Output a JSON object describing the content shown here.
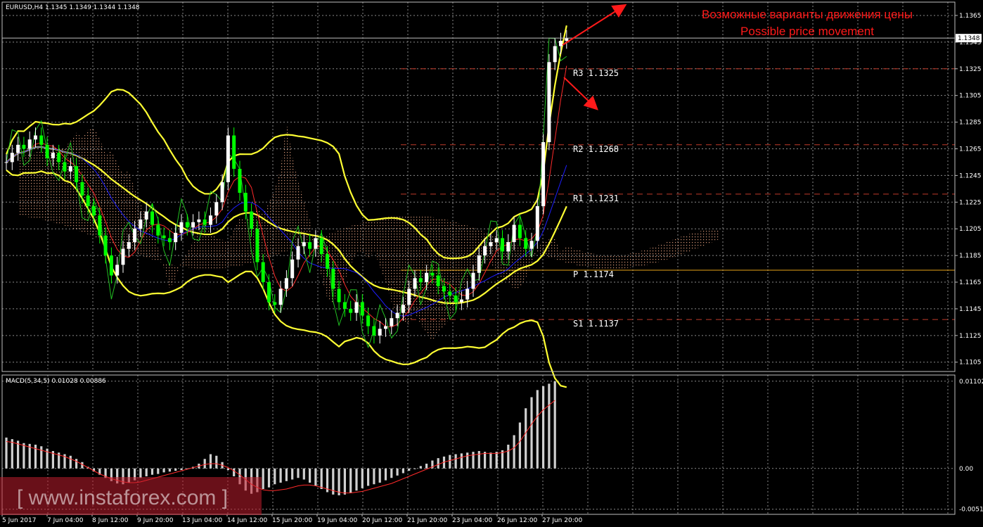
{
  "chart_data": {
    "type": "candlestick",
    "symbol_header": "EURUSD,H4  1.1345 1.1349 1.1344 1.1348",
    "indicator_header": "MACD(5,34,5) 0.01028 0.00886",
    "annotation": {
      "line1": "Возможные варианты движения цены",
      "line2": "Possible price movement"
    },
    "watermark": "[ www.instaforex.com ]",
    "current_price": "1.1348",
    "price_axis": {
      "min": 1.1098,
      "max": 1.1375,
      "ticks": [
        "1.1365",
        "1.1345",
        "1.1325",
        "1.1305",
        "1.1285",
        "1.1265",
        "1.1245",
        "1.1225",
        "1.1205",
        "1.1185",
        "1.1165",
        "1.1145",
        "1.1125",
        "1.1105"
      ]
    },
    "macd_axis": {
      "min": -0.0058,
      "max": 0.0118,
      "ticks": [
        "0.01102",
        "0.00",
        "-0.00515"
      ]
    },
    "time_axis": [
      "5 Jun 2017",
      "7 Jun 04:00",
      "8 Jun 12:00",
      "9 Jun 20:00",
      "13 Jun 04:00",
      "14 Jun 12:00",
      "15 Jun 20:00",
      "19 Jun 04:00",
      "20 Jun 12:00",
      "21 Jun 20:00",
      "23 Jun 04:00",
      "26 Jun 12:00",
      "27 Jun 20:00"
    ],
    "pivot_levels": [
      {
        "label": "R3 1.1325",
        "value": 1.1325,
        "color": "#c03a2b"
      },
      {
        "label": "R2 1.1268",
        "value": 1.1268,
        "color": "#c03a2b"
      },
      {
        "label": "R1 1.1231",
        "value": 1.1231,
        "color": "#c03a2b"
      },
      {
        "label": "P 1.1174",
        "value": 1.1174,
        "color": "#e8a317"
      },
      {
        "label": "S1 1.1137",
        "value": 1.1137,
        "color": "#c03a2b"
      }
    ],
    "closes": [
      1.1255,
      1.1262,
      1.1268,
      1.1265,
      1.1272,
      1.1275,
      1.1268,
      1.1258,
      1.1262,
      1.1255,
      1.1248,
      1.1252,
      1.124,
      1.123,
      1.1222,
      1.1215,
      1.12,
      1.1185,
      1.117,
      1.1178,
      1.119,
      1.1195,
      1.1205,
      1.1212,
      1.1218,
      1.1208,
      1.12,
      1.1198,
      1.1195,
      1.1202,
      1.121,
      1.1206,
      1.121,
      1.1212,
      1.1208,
      1.1215,
      1.1225,
      1.124,
      1.1275,
      1.125,
      1.1232,
      1.1218,
      1.1205,
      1.118,
      1.1165,
      1.115,
      1.1148,
      1.116,
      1.1168,
      1.1182,
      1.1192,
      1.1195,
      1.119,
      1.1198,
      1.1186,
      1.1175,
      1.116,
      1.115,
      1.1145,
      1.1142,
      1.115,
      1.114,
      1.1132,
      1.1125,
      1.113,
      1.1132,
      1.1138,
      1.1142,
      1.1148,
      1.116,
      1.1168,
      1.1165,
      1.1172,
      1.117,
      1.1162,
      1.1158,
      1.1155,
      1.115,
      1.1152,
      1.116,
      1.1172,
      1.1185,
      1.1192,
      1.1195,
      1.1198,
      1.1188,
      1.1195,
      1.1208,
      1.1198,
      1.119,
      1.1196,
      1.1222,
      1.127,
      1.133,
      1.1342,
      1.1346,
      1.1348
    ],
    "macd_hist": [
      0.0039,
      0.0037,
      0.0035,
      0.0032,
      0.0031,
      0.003,
      0.0028,
      0.0025,
      0.0022,
      0.002,
      0.0018,
      0.0016,
      0.0012,
      0.0008,
      0.0002,
      -0.0004,
      -0.0008,
      -0.0012,
      -0.0016,
      -0.0019,
      -0.002,
      -0.0018,
      -0.0015,
      -0.0012,
      -0.001,
      -0.0008,
      -0.0007,
      -0.0005,
      -0.0004,
      -0.0003,
      -0.0002,
      -0.0001,
      0.0002,
      0.0006,
      0.0012,
      0.0018,
      0.0016,
      0.0008,
      -0.0002,
      -0.001,
      -0.002,
      -0.0028,
      -0.0032,
      -0.003,
      -0.0026,
      -0.0024,
      -0.002,
      -0.0018,
      -0.0016,
      -0.0014,
      -0.0012,
      -0.0014,
      -0.0018,
      -0.0022,
      -0.0026,
      -0.003,
      -0.0033,
      -0.0034,
      -0.0033,
      -0.0031,
      -0.0028,
      -0.0025,
      -0.0022,
      -0.002,
      -0.0018,
      -0.0015,
      -0.0012,
      -0.0009,
      -0.0006,
      -0.0003,
      0.0,
      0.0003,
      0.0006,
      0.001,
      0.0013,
      0.0015,
      0.0017,
      0.0018,
      0.0019,
      0.002,
      0.0021,
      0.0022,
      0.0021,
      0.002,
      0.0021,
      0.0023,
      0.003,
      0.0042,
      0.0058,
      0.0076,
      0.009,
      0.0099,
      0.0104,
      0.0107,
      0.011
    ],
    "macd_signal": [
      0.0034,
      0.0033,
      0.0031,
      0.0029,
      0.0027,
      0.0025,
      0.0023,
      0.0021,
      0.0019,
      0.0017,
      0.0015,
      0.0012,
      0.0009,
      0.0005,
      0.0001,
      -0.0003,
      -0.0007,
      -0.001,
      -0.0013,
      -0.0015,
      -0.0017,
      -0.0018,
      -0.0018,
      -0.0017,
      -0.0015,
      -0.0013,
      -0.0011,
      -0.0009,
      -0.0007,
      -0.0005,
      -0.0003,
      -0.0001,
      0.0001,
      0.0003,
      0.0005,
      0.0006,
      0.0006,
      0.0004,
      0.0001,
      -0.0003,
      -0.0008,
      -0.0014,
      -0.002,
      -0.0024,
      -0.0027,
      -0.0028,
      -0.0028,
      -0.0027,
      -0.0026,
      -0.0024,
      -0.0022,
      -0.0021,
      -0.0021,
      -0.0022,
      -0.0024,
      -0.0026,
      -0.0028,
      -0.003,
      -0.0031,
      -0.0031,
      -0.003,
      -0.0029,
      -0.0027,
      -0.0025,
      -0.0023,
      -0.0021,
      -0.0019,
      -0.0016,
      -0.0013,
      -0.001,
      -0.0007,
      -0.0004,
      -0.0001,
      0.0002,
      0.0005,
      0.0008,
      0.001,
      0.0012,
      0.0014,
      0.0016,
      0.0017,
      0.0018,
      0.0019,
      0.0019,
      0.0019,
      0.002,
      0.0022,
      0.0026,
      0.0034,
      0.0045,
      0.0056,
      0.0066,
      0.0074,
      0.008,
      0.0086
    ],
    "colors": {
      "bull": "#ffffff",
      "bear": "#00ff00",
      "bollinger": "#ffff33",
      "ma_fast": "#ff2a2a",
      "ma_slow": "#1e1eff",
      "chikou": "#22c022",
      "cloud": "#ffb48c",
      "grid": "#8a8a8a",
      "annotation": "#ff1a1a"
    }
  }
}
